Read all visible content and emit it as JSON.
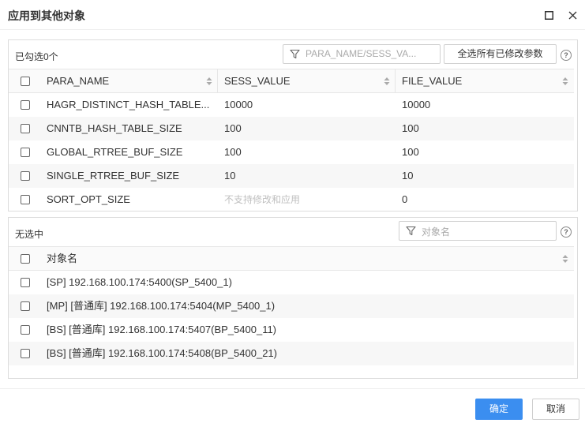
{
  "dialog": {
    "title": "应用到其他对象",
    "maximize_icon": "maximize-icon",
    "close_icon": "close-icon"
  },
  "params_panel": {
    "selected_label": "已勾选0个",
    "filter_placeholder": "PARA_NAME/SESS_VA...",
    "select_all_modified_label": "全选所有已修改参数",
    "help_icon": "help-circle-icon",
    "columns": [
      "PARA_NAME",
      "SESS_VALUE",
      "FILE_VALUE"
    ],
    "rows": [
      {
        "name": "HAGR_DISTINCT_HASH_TABLE...",
        "sess": "10000",
        "file": "10000",
        "sess_disabled": false
      },
      {
        "name": "CNNTB_HASH_TABLE_SIZE",
        "sess": "100",
        "file": "100",
        "sess_disabled": false
      },
      {
        "name": "GLOBAL_RTREE_BUF_SIZE",
        "sess": "100",
        "file": "100",
        "sess_disabled": false
      },
      {
        "name": "SINGLE_RTREE_BUF_SIZE",
        "sess": "10",
        "file": "10",
        "sess_disabled": false
      },
      {
        "name": "SORT_OPT_SIZE",
        "sess": "不支持修改和应用",
        "file": "0",
        "sess_disabled": true
      }
    ]
  },
  "objects_panel": {
    "selected_label": "无选中",
    "filter_placeholder": "对象名",
    "help_icon": "help-circle-icon",
    "column": "对象名",
    "rows": [
      "[SP] 192.168.100.174:5400(SP_5400_1)",
      "[MP] [普通库] 192.168.100.174:5404(MP_5400_1)",
      "[BS] [普通库] 192.168.100.174:5407(BP_5400_11)",
      "[BS] [普通库] 192.168.100.174:5408(BP_5400_21)"
    ]
  },
  "footer": {
    "ok_label": "确定",
    "cancel_label": "取消"
  },
  "colors": {
    "primary": "#3b8ef0",
    "alt_row": "#f7f7f7",
    "disabled_text": "#c0c0c0"
  }
}
